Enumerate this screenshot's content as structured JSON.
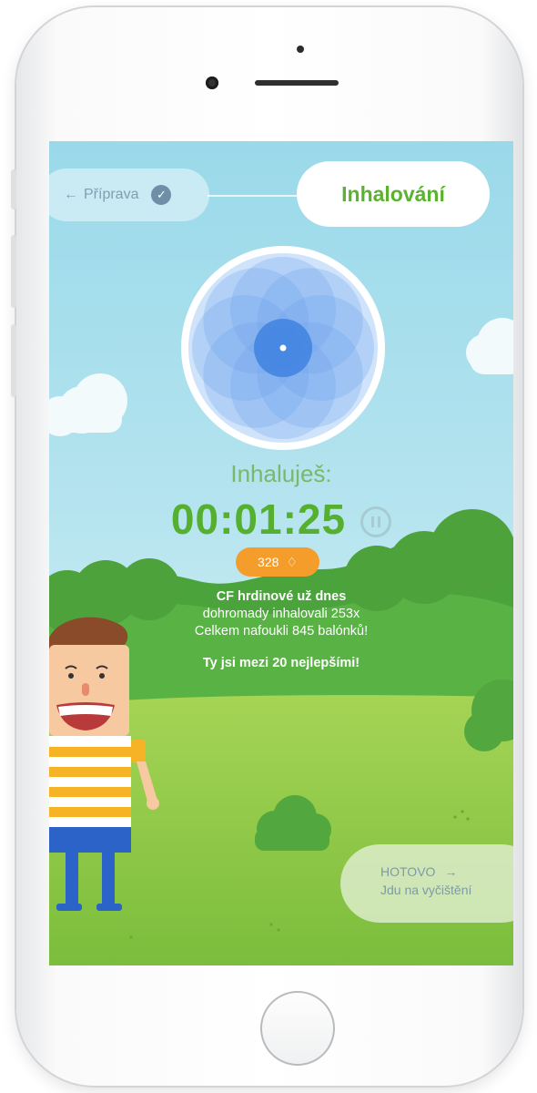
{
  "stepper": {
    "previous_step_label": "Příprava",
    "previous_arrow": "←",
    "previous_done_icon": "check-circle-icon",
    "current_step_label": "Inhalování"
  },
  "breathing": {
    "icon": "breathing-flower-icon",
    "status_label": "Inhaluješ:",
    "timer": "00:01:25",
    "pause_icon": "pause-icon"
  },
  "score": {
    "value": "328",
    "icon": "diamond-icon"
  },
  "community": {
    "line1": "CF hrdinové už dnes",
    "line2": "dohromady inhalovali 253x",
    "line3": "Celkem nafoukli 845 balónků!",
    "rank_line": "Ty jsi mezi 20 nejlepšími!"
  },
  "next_action": {
    "title": "HOTOVO",
    "arrow": "→",
    "subtitle": "Jdu na vyčištění"
  },
  "colors": {
    "accent_green": "#55b030",
    "badge_orange": "#f49d2a",
    "sky": "#9ad9ea",
    "flower_blue": "#4a8fe0"
  }
}
